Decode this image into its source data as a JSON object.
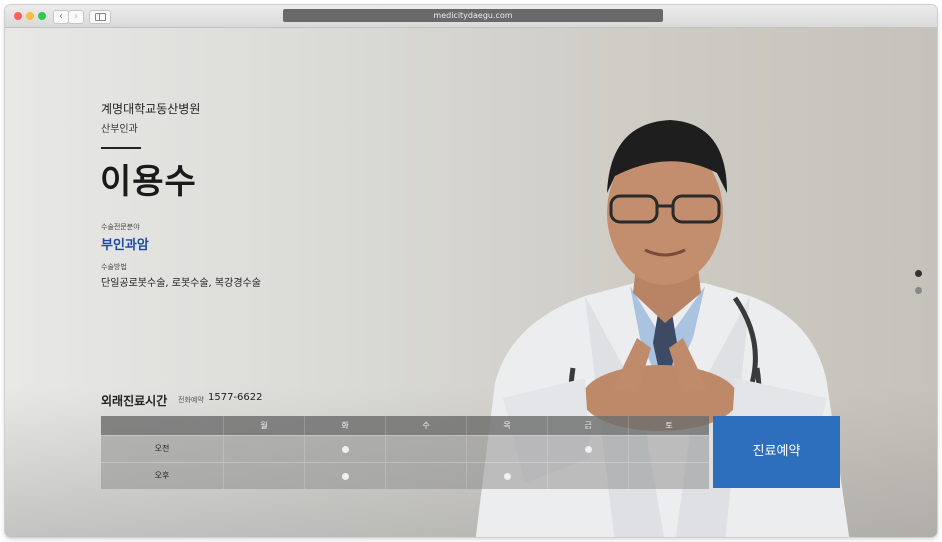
{
  "browser": {
    "url": "medicitydaegu.com"
  },
  "profile": {
    "hospital": "계명대학교동산병원",
    "department": "산부인과",
    "name": "이용수",
    "specialty_label": "수술전문분야",
    "specialty_value": "부인과암",
    "method_label": "수술방법",
    "method_value": "단일공로봇수술, 로봇수술, 복강경수술"
  },
  "schedule": {
    "title": "외래진료시간",
    "phone_label": "전화예약",
    "phone": "1577-6622",
    "days": [
      "월",
      "화",
      "수",
      "목",
      "금",
      "토"
    ],
    "rows": [
      {
        "label": "오전",
        "marks": [
          false,
          true,
          false,
          false,
          true,
          false
        ]
      },
      {
        "label": "오후",
        "marks": [
          false,
          true,
          false,
          true,
          false,
          false
        ]
      }
    ]
  },
  "reserve_button": "진료예약",
  "colors": {
    "accent": "#2e6fbd",
    "specialty_text": "#1e4aa3"
  },
  "pagination": {
    "count": 2,
    "active": 1
  }
}
